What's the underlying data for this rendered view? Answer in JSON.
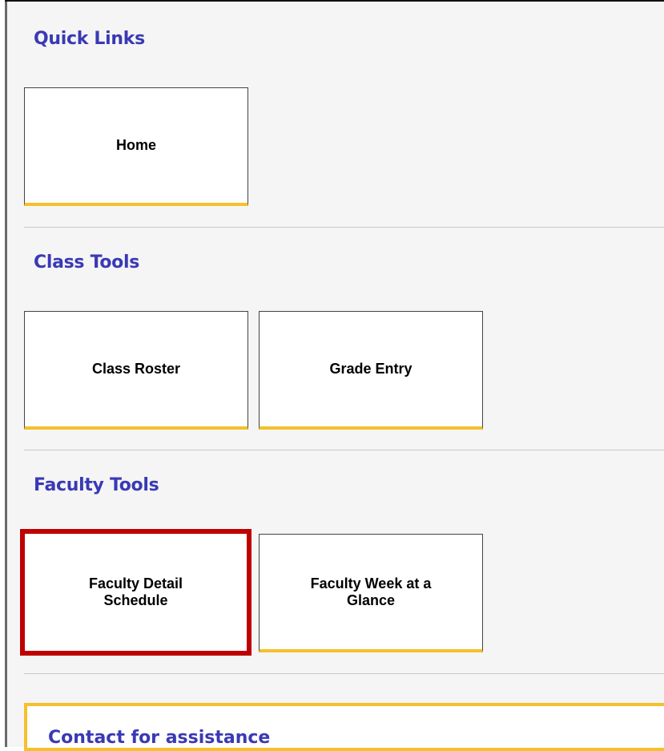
{
  "sections": [
    {
      "title": "Quick Links",
      "tiles": [
        "Home"
      ]
    },
    {
      "title": "Class Tools",
      "tiles": [
        "Class Roster",
        "Grade Entry"
      ]
    },
    {
      "title": "Faculty Tools",
      "tiles": [
        "Faculty Detail Schedule",
        "Faculty Week at a Glance"
      ]
    }
  ],
  "contact": {
    "title": "Contact for assistance"
  },
  "colors": {
    "heading": "#3a39b5",
    "tile_accent": "#f5c02c",
    "highlight": "#bf0000"
  }
}
